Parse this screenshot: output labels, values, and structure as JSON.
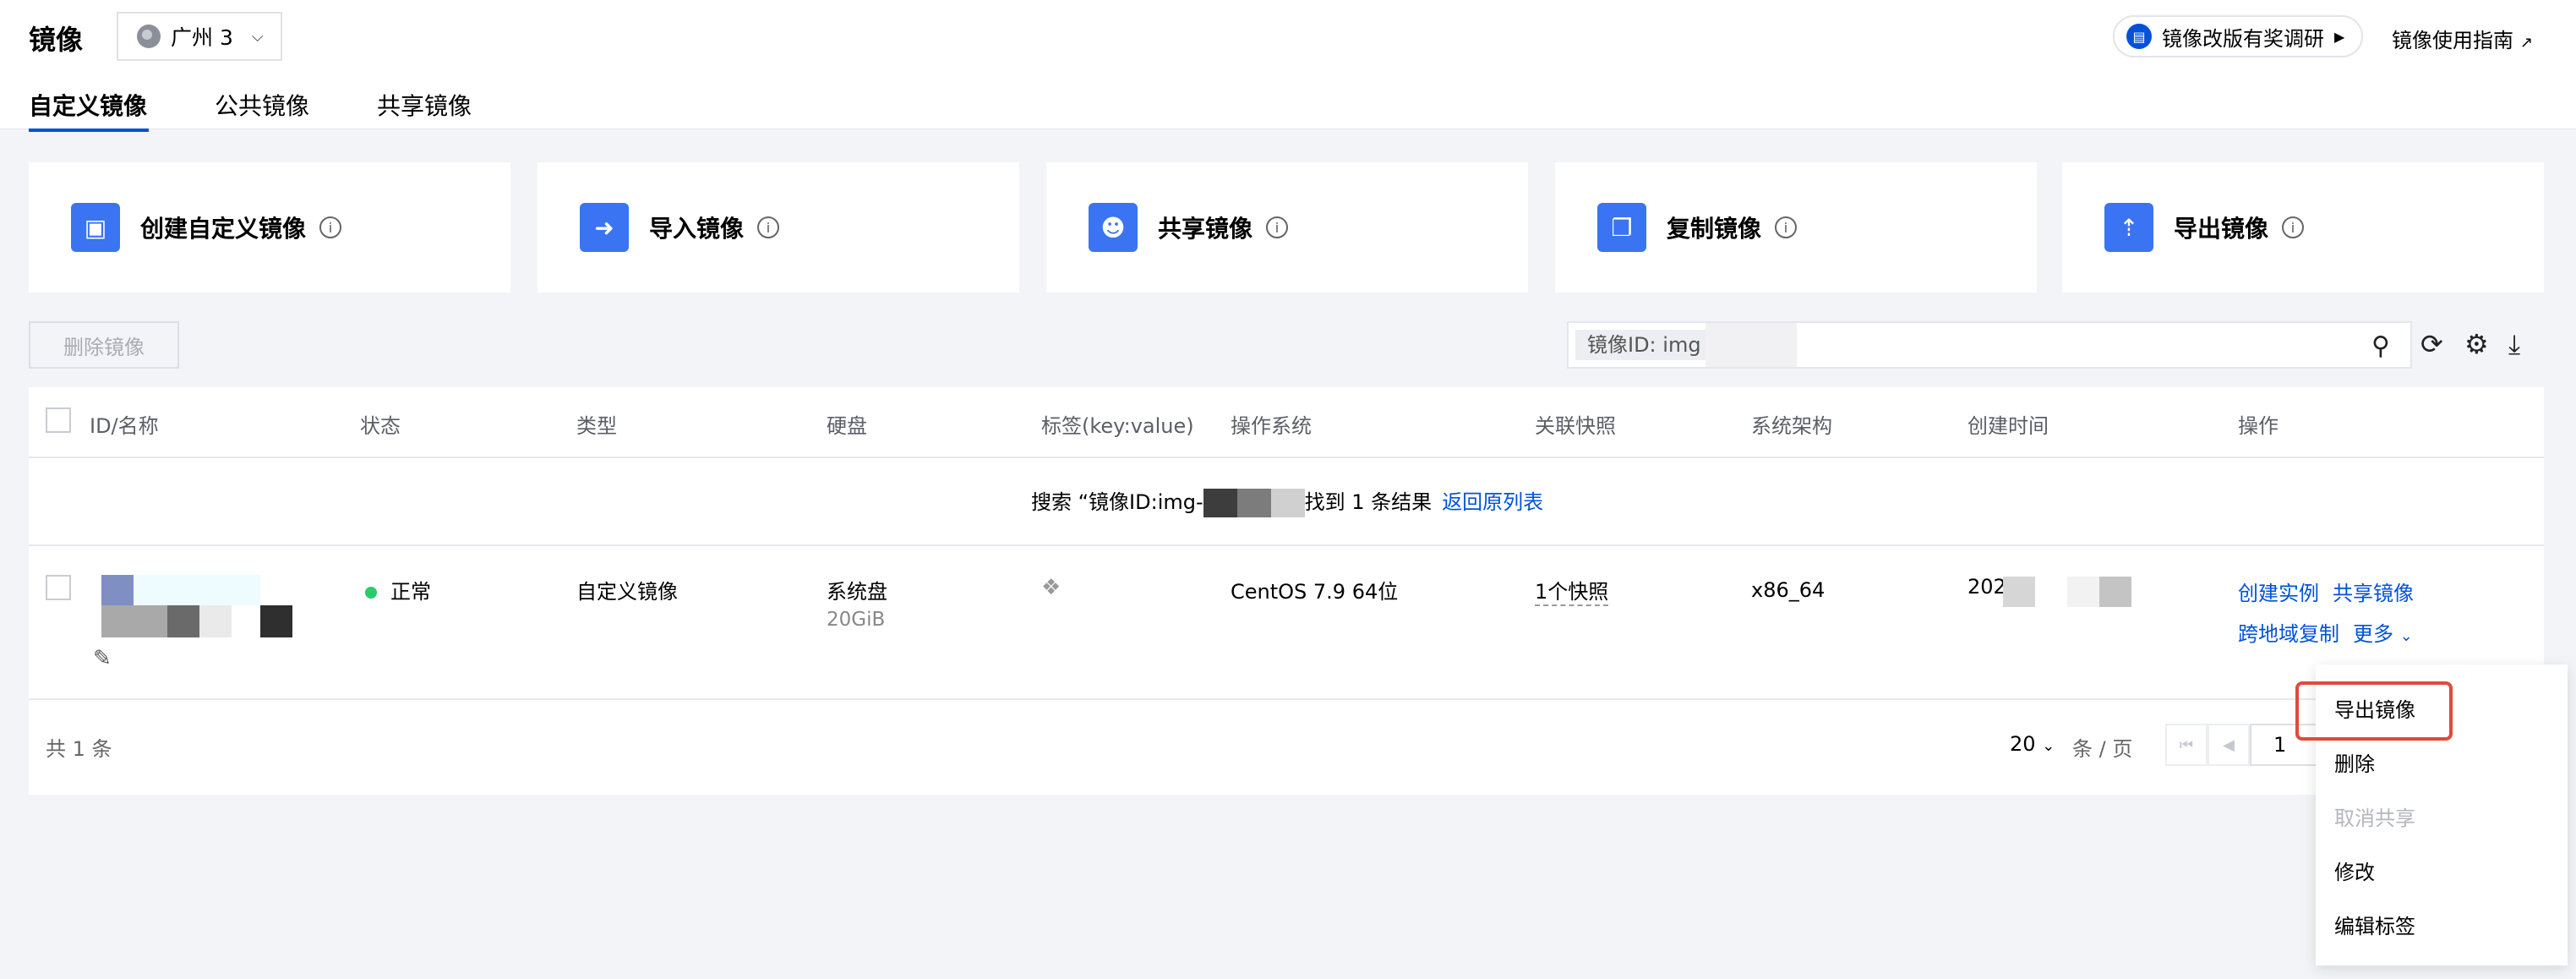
{
  "header": {
    "title": "镜像",
    "region": "广州 3",
    "survey_label": "镜像改版有奖调研",
    "guide_label": "镜像使用指南"
  },
  "tabs": [
    {
      "label": "自定义镜像",
      "active": true
    },
    {
      "label": "公共镜像",
      "active": false
    },
    {
      "label": "共享镜像",
      "active": false
    }
  ],
  "cards": [
    {
      "label": "创建自定义镜像",
      "icon": "create-image-icon"
    },
    {
      "label": "导入镜像",
      "icon": "import-image-icon"
    },
    {
      "label": "共享镜像",
      "icon": "share-image-icon"
    },
    {
      "label": "复制镜像",
      "icon": "copy-image-icon"
    },
    {
      "label": "导出镜像",
      "icon": "export-image-icon"
    }
  ],
  "toolbar": {
    "delete_label": "删除镜像",
    "search_tag": "镜像ID: img"
  },
  "table": {
    "columns": [
      "ID/名称",
      "状态",
      "类型",
      "硬盘",
      "标签(key:value)",
      "操作系统",
      "关联快照",
      "系统架构",
      "创建时间",
      "操作"
    ],
    "search_msg_prefix": "搜索 “镜像ID:img-",
    "search_msg_suffix": "找到 1 条结果",
    "back_link": "返回原列表",
    "row": {
      "status": "正常",
      "type": "自定义镜像",
      "disk_name": "系统盘",
      "disk_size": "20GiB",
      "os": "CentOS 7.9 64位",
      "snapshot": "1个快照",
      "arch": "x86_64",
      "created_prefix": "202",
      "actions": [
        "创建实例",
        "共享镜像",
        "跨地域复制",
        "更多"
      ]
    },
    "total": "共 1 条",
    "page_size": "20",
    "page_unit": "条 / 页",
    "page_input": "1"
  },
  "menu": {
    "items": [
      {
        "label": "导出镜像",
        "disabled": false
      },
      {
        "label": "删除",
        "disabled": false
      },
      {
        "label": "取消共享",
        "disabled": true
      },
      {
        "label": "修改",
        "disabled": false
      },
      {
        "label": "编辑标签",
        "disabled": false
      }
    ]
  },
  "colors": {
    "accent": "#0052d9",
    "status_ok": "#29cc6a",
    "highlight": "#e04a3c"
  }
}
